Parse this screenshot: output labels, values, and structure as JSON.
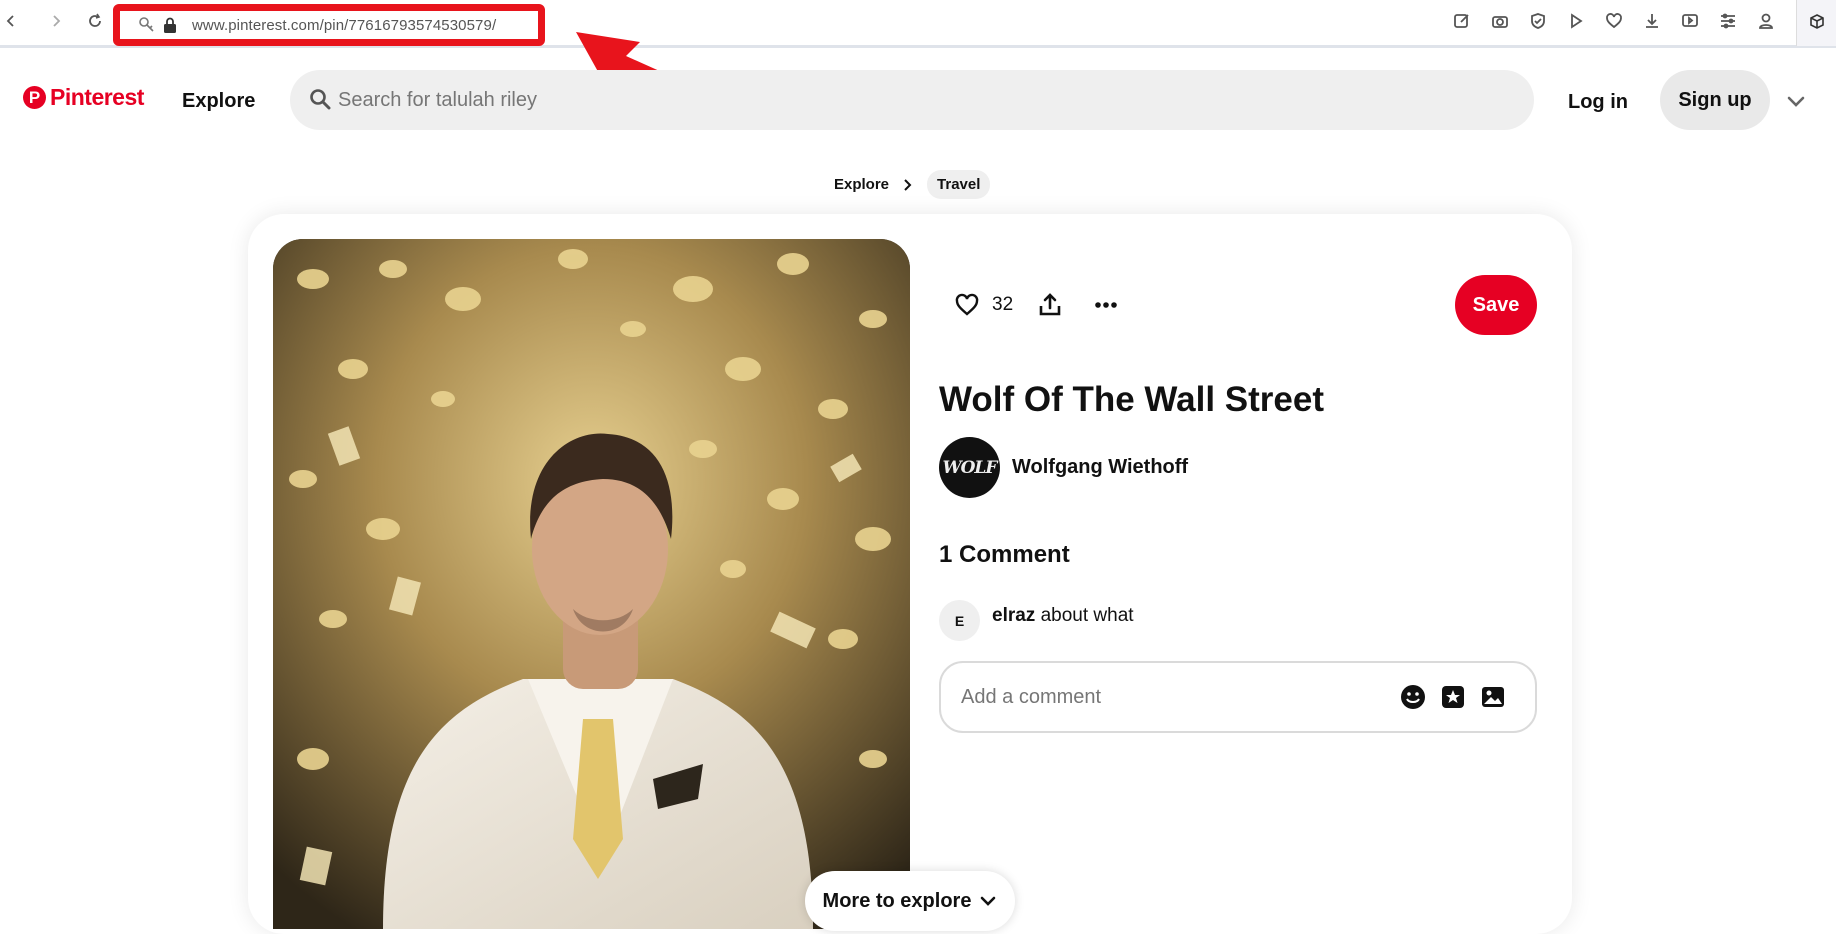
{
  "browser": {
    "url": "www.pinterest.com/pin/776167935745305 79/",
    "url_display": "www.pinterest.com/pin/776167935745305​79/",
    "icons": [
      "back-icon",
      "forward-icon",
      "reload-icon",
      "key-icon",
      "lock-icon",
      "edit-icon",
      "camera-icon",
      "shield-icon",
      "play-icon",
      "heart-icon",
      "download-icon",
      "video-icon",
      "sliders-icon",
      "profile-icon",
      "extension-icon"
    ]
  },
  "annotation": {
    "highlight_color": "#e8141c"
  },
  "header": {
    "logo_text": "Pinterest",
    "explore": "Explore",
    "search_placeholder": "Search for talulah riley",
    "login": "Log in",
    "signup": "Sign up"
  },
  "breadcrumb": [
    "Explore",
    "Travel"
  ],
  "pin": {
    "like_count": "32",
    "save": "Save",
    "title": "Wolf Of The Wall Street",
    "creator_name": "Wolfgang Wiethoff",
    "creator_avatar_text": "WOLF",
    "comments_heading": "1 Comment",
    "comment": {
      "avatar_letter": "E",
      "user": "elraz",
      "text": "about what"
    },
    "comment_placeholder": "Add a comment"
  },
  "more_to_explore": "More to explore",
  "colors": {
    "brand": "#e60023",
    "search_bg": "#efefef"
  }
}
